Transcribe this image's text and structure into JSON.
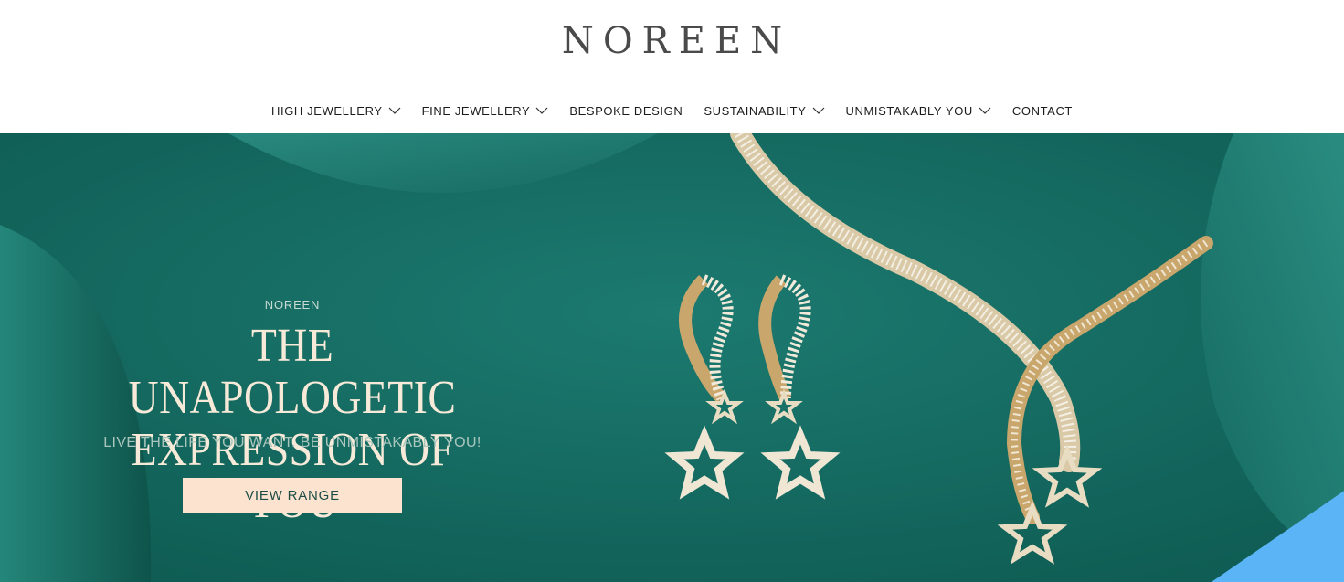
{
  "brand": {
    "logo": "NOREEN"
  },
  "nav": {
    "items": [
      {
        "label": "HIGH JEWELLERY",
        "has_dropdown": true
      },
      {
        "label": "FINE JEWELLERY",
        "has_dropdown": true
      },
      {
        "label": "BESPOKE DESIGN",
        "has_dropdown": false
      },
      {
        "label": "SUSTAINABILITY",
        "has_dropdown": true
      },
      {
        "label": "UNMISTAKABLY YOU",
        "has_dropdown": true
      },
      {
        "label": "CONTACT",
        "has_dropdown": false
      }
    ]
  },
  "hero": {
    "eyebrow": "NOREEN",
    "headline_line1": "THE UNAPOLOGETIC",
    "headline_line2": "EXPRESSION OF YOU",
    "subline": "LIVE THE LIFE YOU WANT. BE UNMISTAKABLY YOU!",
    "cta_label": "VIEW RANGE",
    "image_icon": "earrings-and-necklace-photo"
  },
  "colors": {
    "hero_bg": "#166d63",
    "cta_bg": "#fbe3cf",
    "headline": "#f7ead9",
    "accent_corner": "#5ab4f5"
  }
}
